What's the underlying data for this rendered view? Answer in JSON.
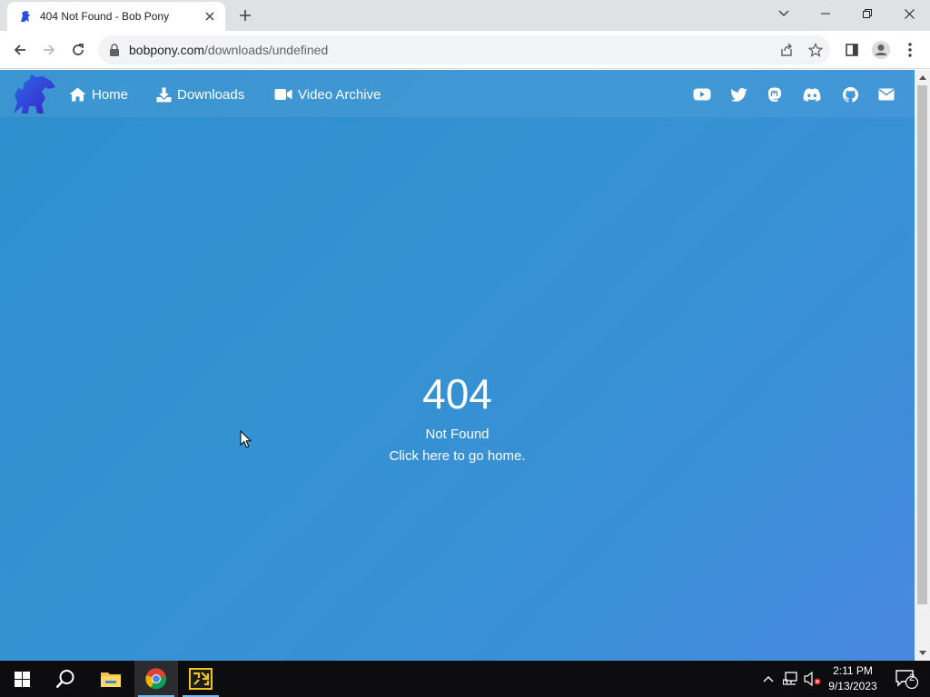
{
  "browser": {
    "tab": {
      "title": "404 Not Found - Bob Pony"
    },
    "url": {
      "domain": "bobpony.com",
      "path": "/downloads/undefined"
    }
  },
  "site": {
    "nav": {
      "links": [
        {
          "label": "Home",
          "icon": "home-icon"
        },
        {
          "label": "Downloads",
          "icon": "download-icon"
        },
        {
          "label": "Video Archive",
          "icon": "video-camera-icon"
        }
      ],
      "social": [
        "youtube-icon",
        "twitter-icon",
        "mastodon-icon",
        "discord-icon",
        "github-icon",
        "mail-icon"
      ]
    },
    "error": {
      "code": "404",
      "message": "Not Found",
      "link": "Click here to go home."
    },
    "colors": {
      "gradient_start": "#2f8fce",
      "gradient_end": "#4a88e0",
      "text": "#ffffff"
    }
  },
  "taskbar": {
    "time": "2:11 PM",
    "date": "9/13/2023",
    "notification_count": "2"
  }
}
